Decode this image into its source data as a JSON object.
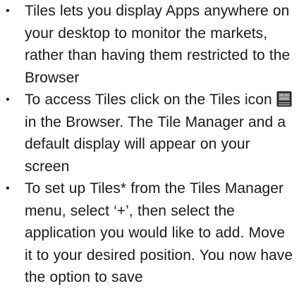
{
  "bullet_symbol": "•",
  "items": [
    {
      "text": "Tiles lets you display Apps anywhere on your desktop to monitor the markets, rather than having them restricted to the Browser"
    },
    {
      "text_before_icon": "To access Tiles click on the Tiles icon ",
      "icon": "tiles-icon",
      "text_after_icon": "in the Browser. The Tile Manager and a default display will appear on your screen"
    },
    {
      "text": "To set up Tiles* from the Tiles Manager menu, select ‘+’, then select the application you would like to add. Move it to your desired position. You now have the option to save"
    }
  ],
  "colors": {
    "text": "#1a1a1a",
    "icon_frame": "#2b2b2b",
    "icon_screen": "#6e6e6e",
    "icon_screen_light": "#a9a9a9"
  }
}
